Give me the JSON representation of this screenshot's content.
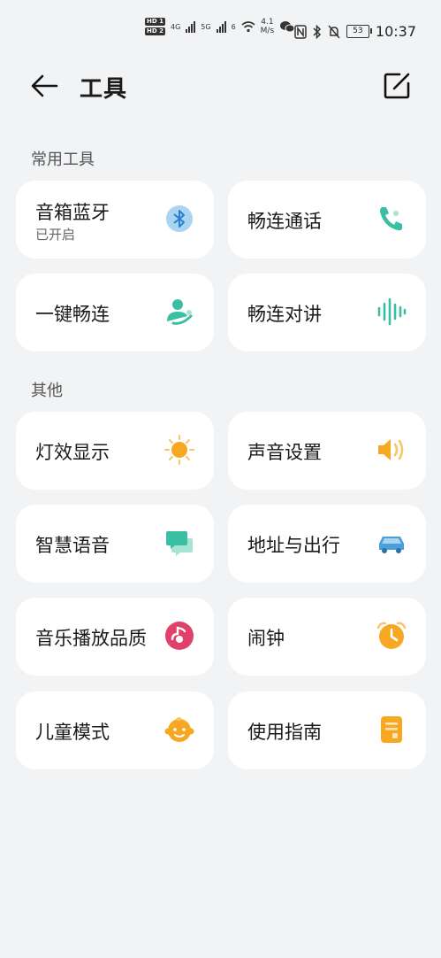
{
  "status_bar": {
    "hd1": "HD 1",
    "hd2": "HD 2",
    "net1": "4G",
    "net2": "5G",
    "net3": "6",
    "speed_value": "4.1",
    "speed_unit": "M/s",
    "battery": "53",
    "time": "10:37"
  },
  "header": {
    "title": "工具"
  },
  "sections": {
    "common": {
      "label": "常用工具",
      "items": [
        {
          "label": "音箱蓝牙",
          "sub": "已开启",
          "icon": "bluetooth-icon",
          "color": "#3b8fd9"
        },
        {
          "label": "畅连通话",
          "icon": "phone-call-icon",
          "color": "#3bbfa3"
        },
        {
          "label": "一键畅连",
          "icon": "person-connect-icon",
          "color": "#3bbfa3"
        },
        {
          "label": "畅连对讲",
          "icon": "voice-wave-icon",
          "color": "#3bbfa3"
        }
      ]
    },
    "other": {
      "label": "其他",
      "items": [
        {
          "label": "灯效显示",
          "icon": "sun-icon",
          "color": "#f7a823"
        },
        {
          "label": "声音设置",
          "icon": "speaker-icon",
          "color": "#f7a823"
        },
        {
          "label": "智慧语音",
          "icon": "chat-bubble-icon",
          "color": "#3bbfa3"
        },
        {
          "label": "地址与出行",
          "icon": "car-icon",
          "color": "#4a9fd8"
        },
        {
          "label": "音乐播放品质",
          "icon": "music-disc-icon",
          "color": "#e0406a"
        },
        {
          "label": "闹钟",
          "icon": "alarm-clock-icon",
          "color": "#f7a823"
        },
        {
          "label": "儿童模式",
          "icon": "child-face-icon",
          "color": "#f7a823"
        },
        {
          "label": "使用指南",
          "icon": "guide-book-icon",
          "color": "#f7a823"
        }
      ]
    }
  }
}
